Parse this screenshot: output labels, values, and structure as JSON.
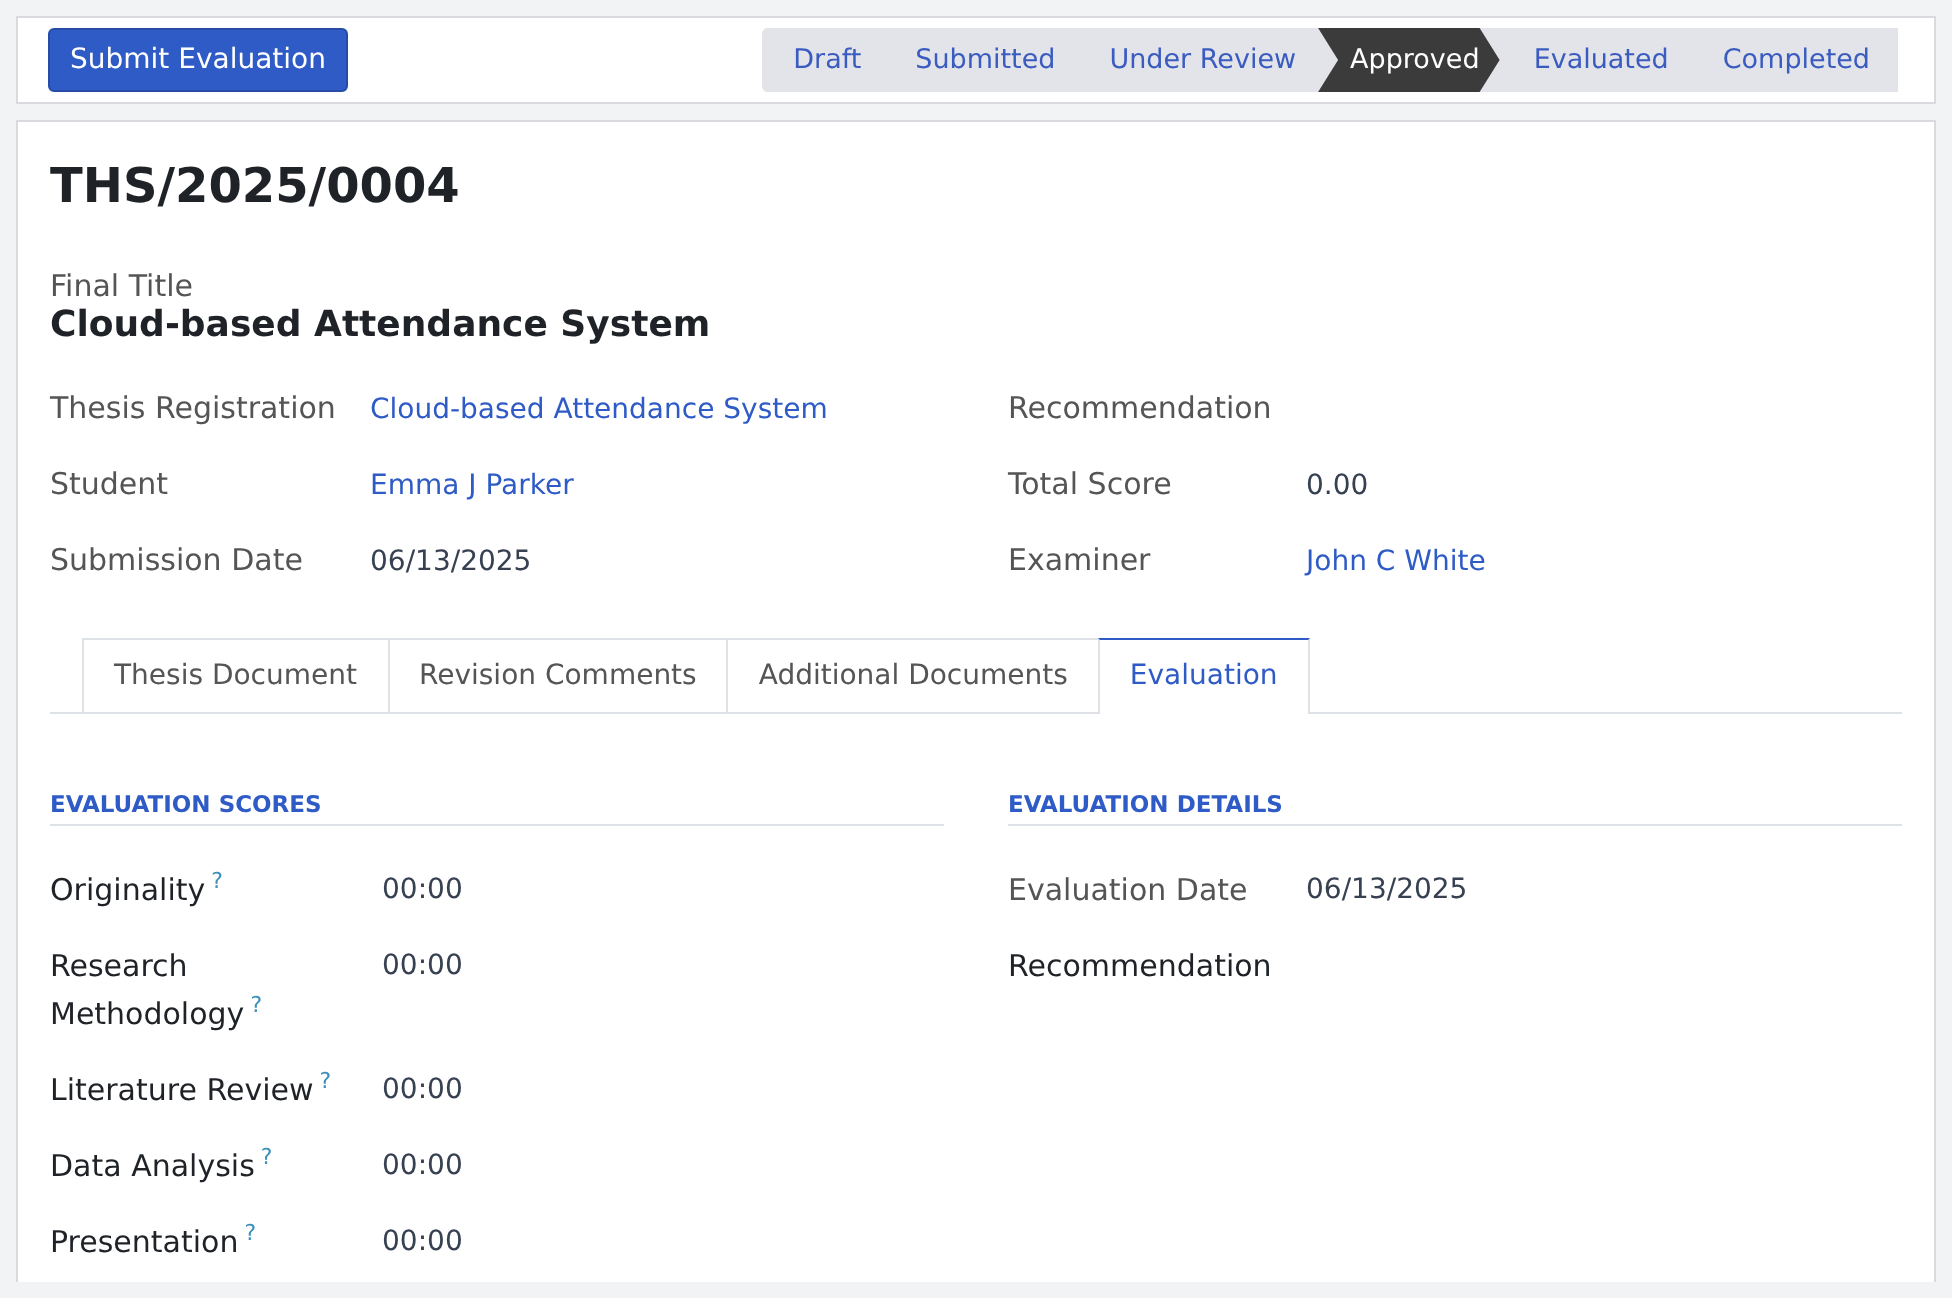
{
  "action_button": "Submit Evaluation",
  "stages": [
    {
      "label": "Draft",
      "selected": false
    },
    {
      "label": "Submitted",
      "selected": false
    },
    {
      "label": "Under Review",
      "selected": false
    },
    {
      "label": "Approved",
      "selected": true
    },
    {
      "label": "Evaluated",
      "selected": false
    },
    {
      "label": "Completed",
      "selected": false
    }
  ],
  "record_name": "THS/2025/0004",
  "final_title": {
    "label": "Final Title",
    "value": "Cloud-based Attendance System"
  },
  "left_fields": [
    {
      "label": "Thesis Registration",
      "value": "Cloud-based Attendance System",
      "kind": "link"
    },
    {
      "label": "Student",
      "value": "Emma J Parker",
      "kind": "link"
    },
    {
      "label": "Submission Date",
      "value": "06/13/2025",
      "kind": "text"
    }
  ],
  "right_fields": [
    {
      "label": "Recommendation",
      "kind": "empty"
    },
    {
      "label": "Total Score",
      "value": "0.00",
      "kind": "text"
    },
    {
      "label": "Examiner",
      "value": "John C White",
      "kind": "link"
    }
  ],
  "tabs": [
    {
      "label": "Thesis Document",
      "selected": false
    },
    {
      "label": "Revision Comments",
      "selected": false
    },
    {
      "label": "Additional Documents",
      "selected": false
    },
    {
      "label": "Evaluation",
      "selected": true
    }
  ],
  "scores": {
    "heading": "EVALUATION SCORES",
    "rows": [
      {
        "label": "Originality",
        "help": "?",
        "value": "00:00"
      },
      {
        "label": "Research Methodology",
        "help": "?",
        "value": "00:00"
      },
      {
        "label": "Literature Review",
        "help": "?",
        "value": "00:00"
      },
      {
        "label": "Data Analysis",
        "help": "?",
        "value": "00:00"
      },
      {
        "label": "Presentation",
        "help": "?",
        "value": "00:00"
      }
    ]
  },
  "details": {
    "heading": "EVALUATION DETAILS",
    "rows": [
      {
        "label": "Evaluation Date",
        "value": "06/13/2025",
        "kind": "text"
      },
      {
        "label": "Recommendation",
        "kind": "empty"
      }
    ]
  }
}
